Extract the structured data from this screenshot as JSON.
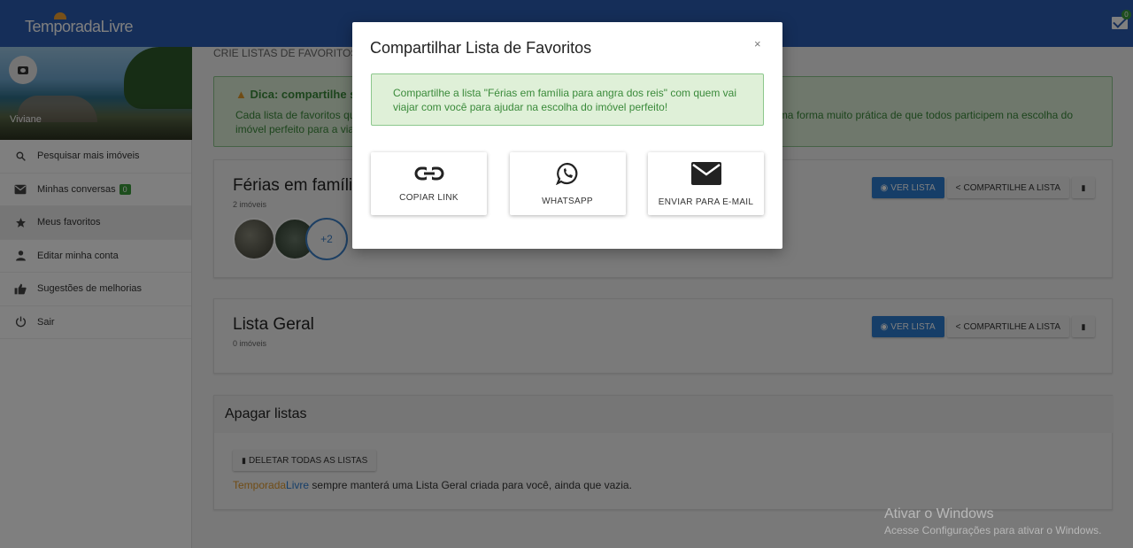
{
  "header": {
    "logo": "TemporadaLivre",
    "mail_count": "0"
  },
  "sidebar": {
    "user_name": "Viviane",
    "items": [
      {
        "label": "Pesquisar mais imóveis",
        "icon": "search-icon"
      },
      {
        "label": "Minhas conversas",
        "icon": "mail-icon",
        "badge": "0"
      },
      {
        "label": "Meus favoritos",
        "icon": "star-icon"
      },
      {
        "label": "Editar minha conta",
        "icon": "person-icon"
      },
      {
        "label": "Sugestões de melhorias",
        "icon": "thumbs-up-icon"
      },
      {
        "label": "Sair",
        "icon": "power-icon"
      }
    ]
  },
  "main": {
    "heading": "CRIE LISTAS DE FAVORITOS",
    "tip_title": "Dica: compartilhe s",
    "tip_line1": "Cada lista de favoritos que",
    "tip_line1b": "uma forma muito prática de que todos participem na escolha do",
    "tip_line2": "imóvel perfeito para a viag",
    "lists": [
      {
        "title": "Férias em famíli",
        "count": "2 imóveis",
        "more": "+2"
      },
      {
        "title": "Lista Geral",
        "count": "0 imóveis"
      }
    ],
    "buttons": {
      "view": "VER LISTA",
      "share": "COMPARTILHE A LISTA"
    },
    "delete_section": {
      "title": "Apagar listas",
      "button": "DELETAR TODAS AS LISTAS",
      "note_part1": "Temporada",
      "note_part2": "Livre",
      "note_rest": " sempre manterá uma Lista Geral criada para você, ainda que vazia."
    }
  },
  "watermark": {
    "line1": "Ativar o Windows",
    "line2": "Acesse Configurações para ativar o Windows."
  },
  "modal": {
    "title": "Compartilhar Lista de Favoritos",
    "close": "×",
    "alert": "Compartilhe a lista \"Férias em família para angra dos reis\" com quem vai viajar com você para ajudar na escolha do imóvel perfeito!",
    "options": [
      {
        "label": "COPIAR LINK",
        "icon": "link-icon"
      },
      {
        "label": "WHATSAPP",
        "icon": "whatsapp-icon"
      },
      {
        "label": "ENVIAR PARA E-MAIL",
        "icon": "email-icon"
      }
    ]
  },
  "colors": {
    "primary": "#2b5db3",
    "button_blue": "#2c7cd1",
    "success_bg": "#dff0d8",
    "success_text": "#3a8a3a",
    "accent_orange": "#e0992b"
  }
}
